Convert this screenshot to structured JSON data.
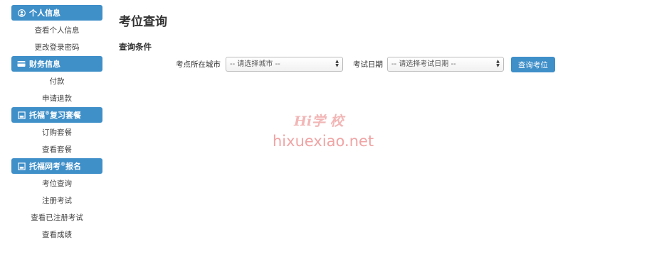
{
  "sidebar": {
    "sections": [
      {
        "title": "个人信息",
        "title_sup": "",
        "title_suffix": "",
        "icon": "user-circle-icon",
        "items": [
          "查看个人信息",
          "更改登录密码"
        ]
      },
      {
        "title": "财务信息",
        "title_sup": "",
        "title_suffix": "",
        "icon": "credit-card-icon",
        "items": [
          "付款",
          "申请退款"
        ]
      },
      {
        "title": "托福",
        "title_sup": "®",
        "title_suffix": "复习套餐",
        "icon": "book-icon",
        "items": [
          "订购套餐",
          "查看套餐"
        ]
      },
      {
        "title": "托福网考",
        "title_sup": "®",
        "title_suffix": "报名",
        "icon": "book-icon",
        "items": [
          "考位查询",
          "注册考试",
          "查看已注册考试",
          "查看成绩"
        ]
      }
    ]
  },
  "main": {
    "page_title": "考位查询",
    "conditions_title": "查询条件",
    "city_label": "考点所在城市",
    "city_select": "-- 请选择城市 --",
    "date_label": "考试日期",
    "date_select": "-- 请选择考试日期 --",
    "query_button": "查询考位"
  },
  "watermark": {
    "logo": "Hi学 校",
    "url": "hixuexiao.net"
  },
  "colors": {
    "accent": "#3f8fc9",
    "watermark": "#f0a4a4"
  }
}
